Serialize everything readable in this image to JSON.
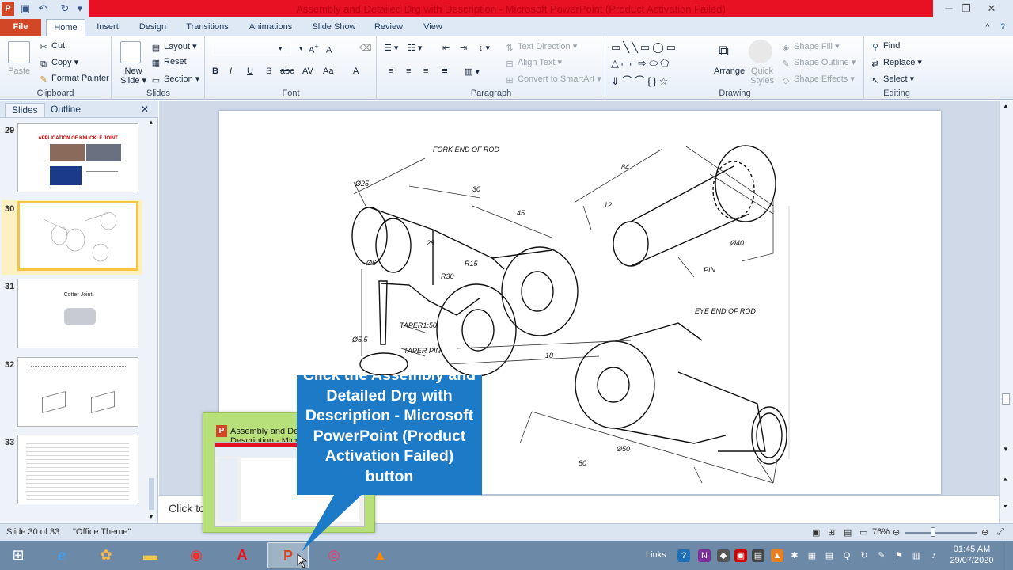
{
  "titlebar": {
    "title": "Assembly and Detailed Drg with Description  -  Microsoft PowerPoint (Product Activation Failed)",
    "app_icon": "P",
    "minimize": "─",
    "maximize": "❐",
    "close": "✕"
  },
  "tabs": [
    "File",
    "Home",
    "Insert",
    "Design",
    "Transitions",
    "Animations",
    "Slide Show",
    "Review",
    "View"
  ],
  "ribbon": {
    "clipboard": {
      "label": "Clipboard",
      "paste": "Paste",
      "cut": "Cut",
      "copy": "Copy",
      "format_painter": "Format Painter"
    },
    "slides": {
      "label": "Slides",
      "new_slide": "New Slide",
      "new_slide_line2": "Slide",
      "layout": "Layout",
      "reset": "Reset",
      "section": "Section"
    },
    "font": {
      "label": "Font",
      "bold": "B",
      "italic": "I",
      "underline": "U",
      "strike": "S",
      "shadow": "abc",
      "spacing": "AV",
      "case": "Aa",
      "color": "A"
    },
    "paragraph": {
      "label": "Paragraph",
      "text_direction": "Text Direction",
      "align_text": "Align Text",
      "smartart": "Convert to SmartArt"
    },
    "drawing": {
      "label": "Drawing",
      "arrange": "Arrange",
      "quick_styles": "Quick",
      "quick_styles_line2": "Styles",
      "shape_fill": "Shape Fill",
      "shape_outline": "Shape Outline",
      "shape_effects": "Shape Effects"
    },
    "editing": {
      "label": "Editing",
      "find": "Find",
      "replace": "Replace",
      "select": "Select"
    }
  },
  "leftpanel": {
    "tab_slides": "Slides",
    "tab_outline": "Outline",
    "close": "✕",
    "slides": [
      {
        "num": "29",
        "title": "APPLICATION OF KNUCKLE JOINT"
      },
      {
        "num": "30",
        "title": ""
      },
      {
        "num": "31",
        "title": "Cotter Joint"
      },
      {
        "num": "32",
        "title": ""
      },
      {
        "num": "33",
        "title": ""
      }
    ]
  },
  "slide_labels": {
    "fork_end": "FORK END OF ROD",
    "pin": "PIN",
    "eye_end": "EYE END OF ROD",
    "taper": "TAPER1:50",
    "taper_pin": "TAPER PIN",
    "d25": "Ø25",
    "d30": "30",
    "d45": "45",
    "d28": "28",
    "r15": "R15",
    "r30": "R30",
    "d84": "84",
    "d12": "12",
    "d40": "Ø40",
    "d50": "Ø50",
    "d80": "80",
    "d18": "18",
    "d55": "Ø5.5",
    "d6": "Ø6"
  },
  "notes": {
    "placeholder": "Click to add notes"
  },
  "statusbar": {
    "slide_info": "Slide 30 of 33",
    "theme": "\"Office Theme\"",
    "zoom": "76%"
  },
  "popup": {
    "title": "Assembly and Detailed Drg with Description  -  Microsoft PowerPoint (Product Activation Failed)"
  },
  "callout": {
    "text": "Click the Assembly and Detailed Drg with Description - Microsoft PowerPoint (Product Activation Failed) button"
  },
  "taskbar": {
    "links": "Links",
    "time": "01:45 AM",
    "date": "29/07/2020",
    "apps": [
      "start-button",
      "ie",
      "paint",
      "explorer",
      "chrome",
      "acrobat",
      "powerpoint",
      "app-circle",
      "vlc"
    ]
  },
  "colors": {
    "title_red": "#e81123",
    "file_tab": "#d24726",
    "callout_blue": "#1d7ac6",
    "popup_green": "#b8e07a",
    "selected_slide": "#f6c546"
  }
}
